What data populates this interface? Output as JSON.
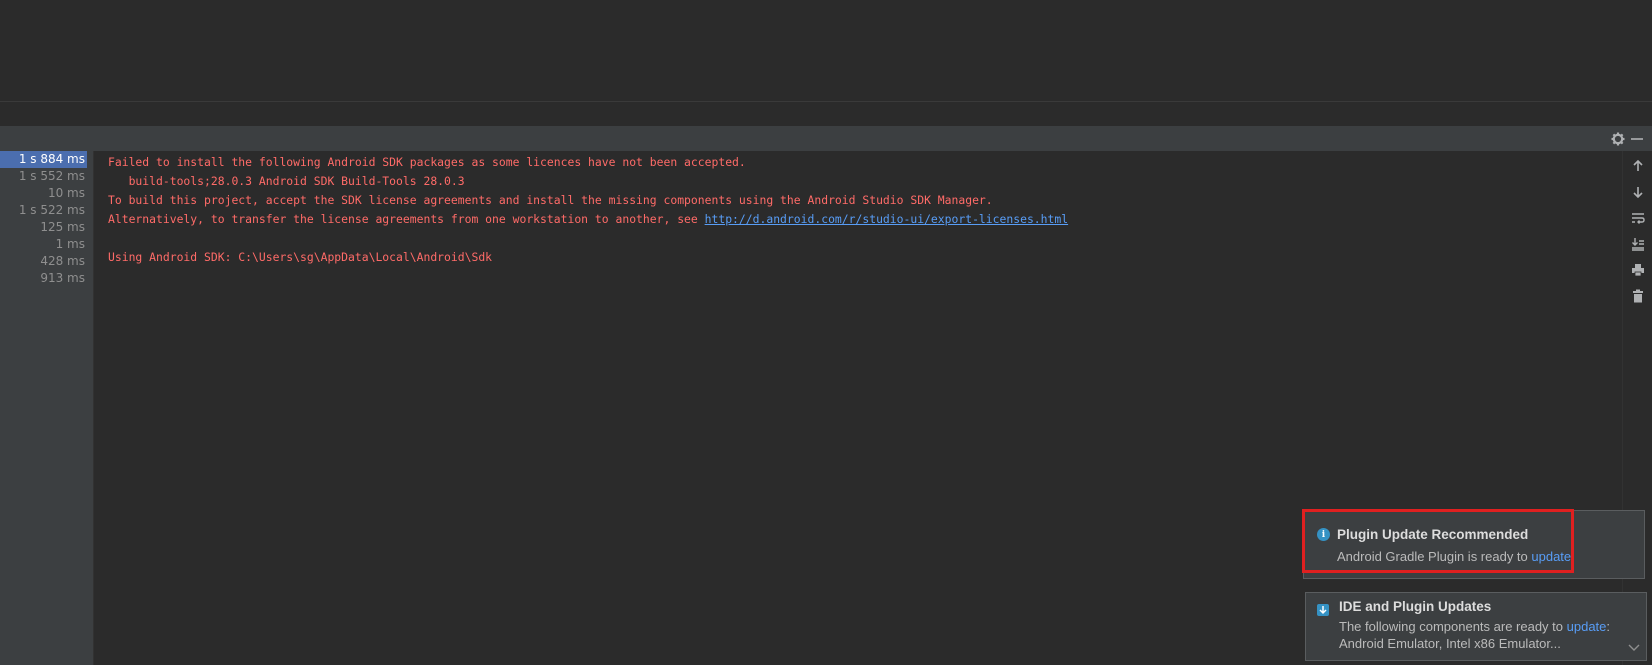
{
  "run_panel": {
    "durations": [
      {
        "text": "1 s 884 ms",
        "selected": true
      },
      {
        "text": "1 s 552 ms",
        "selected": false
      },
      {
        "text": "10 ms",
        "selected": false
      },
      {
        "text": "1 s 522 ms",
        "selected": false
      },
      {
        "text": "125 ms",
        "selected": false
      },
      {
        "text": "1 ms",
        "selected": false
      },
      {
        "text": "428 ms",
        "selected": false
      },
      {
        "text": "913 ms",
        "selected": false
      }
    ],
    "console": {
      "line1": "Failed to install the following Android SDK packages as some licences have not been accepted.",
      "line2": "   build-tools;28.0.3 Android SDK Build-Tools 28.0.3",
      "line3": "To build this project, accept the SDK license agreements and install the missing components using the Android Studio SDK Manager.",
      "line4_prefix": "Alternatively, to transfer the license agreements from one workstation to another, see ",
      "line4_link": "http://d.android.com/r/studio-ui/export-licenses.html",
      "line5": "Using Android SDK: C:\\Users\\sg\\AppData\\Local\\Android\\Sdk"
    },
    "colors": {
      "error_text": "#ff6b68",
      "link": "#589df6",
      "selection": "#4b6eaf"
    }
  },
  "notifications": [
    {
      "icon": "info-icon",
      "title": "Plugin Update Recommended",
      "body_prefix": "Android Gradle Plugin is ready to ",
      "body_link": "update",
      "body_suffix": "."
    },
    {
      "icon": "update-icon",
      "title": "IDE and Plugin Updates",
      "body_prefix": "The following components are ready to ",
      "body_link": "update",
      "body_suffix": ":",
      "body_line2": "Android Emulator, Intel x86 Emulator..."
    }
  ],
  "icons": {
    "toolbar": [
      "gear-icon",
      "minimize-icon"
    ],
    "rail": [
      "arrow-up-icon",
      "arrow-down-icon",
      "soft-wrap-icon",
      "scroll-to-end-icon",
      "print-icon",
      "trash-icon"
    ]
  }
}
